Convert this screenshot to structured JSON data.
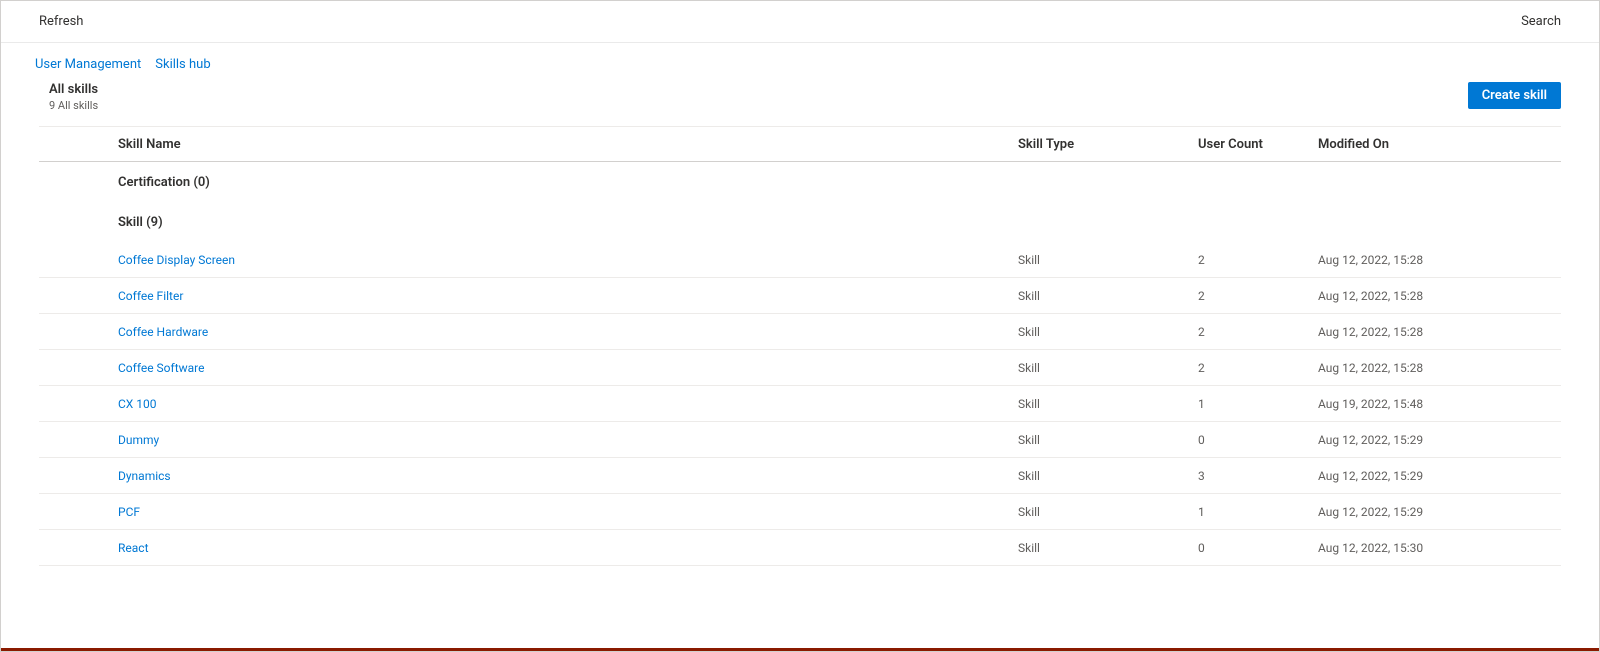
{
  "topbar": {
    "refresh_label": "Refresh",
    "search_label": "Search"
  },
  "breadcrumb": {
    "item0": "User Management",
    "item1": "Skills hub"
  },
  "header": {
    "title": "All skills",
    "subtitle": "9 All skills",
    "create_button": "Create skill"
  },
  "columns": {
    "name": "Skill Name",
    "type": "Skill Type",
    "count": "User Count",
    "modified": "Modified On"
  },
  "groups": {
    "cert": "Certification (0)",
    "skill": "Skill (9)"
  },
  "rows": [
    {
      "name": "Coffee Display Screen",
      "type": "Skill",
      "count": "2",
      "modified": "Aug 12, 2022, 15:28"
    },
    {
      "name": "Coffee Filter",
      "type": "Skill",
      "count": "2",
      "modified": "Aug 12, 2022, 15:28"
    },
    {
      "name": "Coffee Hardware",
      "type": "Skill",
      "count": "2",
      "modified": "Aug 12, 2022, 15:28"
    },
    {
      "name": "Coffee Software",
      "type": "Skill",
      "count": "2",
      "modified": "Aug 12, 2022, 15:28"
    },
    {
      "name": "CX 100",
      "type": "Skill",
      "count": "1",
      "modified": "Aug 19, 2022, 15:48"
    },
    {
      "name": "Dummy",
      "type": "Skill",
      "count": "0",
      "modified": "Aug 12, 2022, 15:29"
    },
    {
      "name": "Dynamics",
      "type": "Skill",
      "count": "3",
      "modified": "Aug 12, 2022, 15:29"
    },
    {
      "name": "PCF",
      "type": "Skill",
      "count": "1",
      "modified": "Aug 12, 2022, 15:29"
    },
    {
      "name": "React",
      "type": "Skill",
      "count": "0",
      "modified": "Aug 12, 2022, 15:30"
    }
  ]
}
